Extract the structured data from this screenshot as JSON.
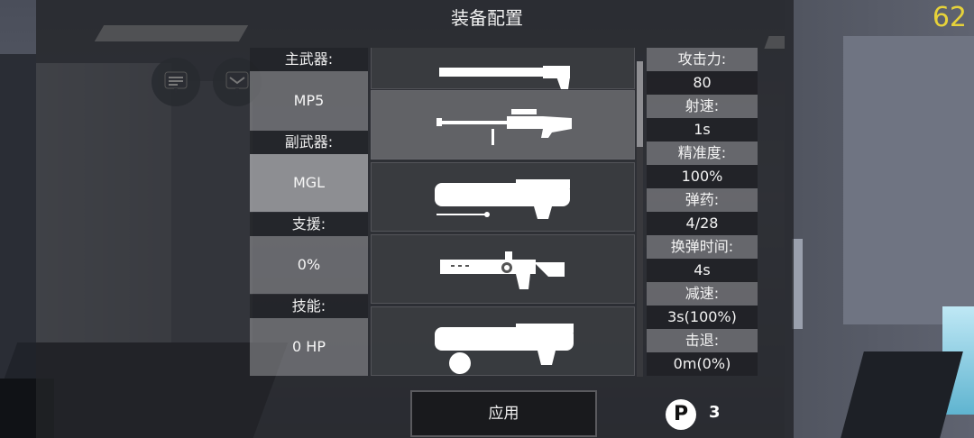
{
  "title": "装备配置",
  "fps": "62",
  "slots": {
    "primary_label": "主武器:",
    "primary_value": "MP5",
    "secondary_label": "副武器:",
    "secondary_value": "MGL",
    "support_label": "支援:",
    "support_value": "0%",
    "skill_label": "技能:",
    "skill_value": "0 HP"
  },
  "weapons": [
    {
      "icon": "rifle-top-icon"
    },
    {
      "icon": "sniper-rifle-icon"
    },
    {
      "icon": "grenade-launcher-icon"
    },
    {
      "icon": "rocket-launcher-icon"
    },
    {
      "icon": "plasma-cannon-icon"
    }
  ],
  "stats": [
    {
      "label": "攻击力:",
      "value": "80"
    },
    {
      "label": "射速:",
      "value": "1s"
    },
    {
      "label": "精准度:",
      "value": "100%"
    },
    {
      "label": "弹药:",
      "value": "4/28"
    },
    {
      "label": "换弹时间:",
      "value": "4s"
    },
    {
      "label": "减速:",
      "value": "3s(100%)"
    },
    {
      "label": "击退:",
      "value": "0m(0%)"
    }
  ],
  "apply_label": "应用",
  "points": {
    "icon": "P",
    "value": "3"
  },
  "colors": {
    "fps": "#e6d23a",
    "accent": "#ffffff"
  }
}
